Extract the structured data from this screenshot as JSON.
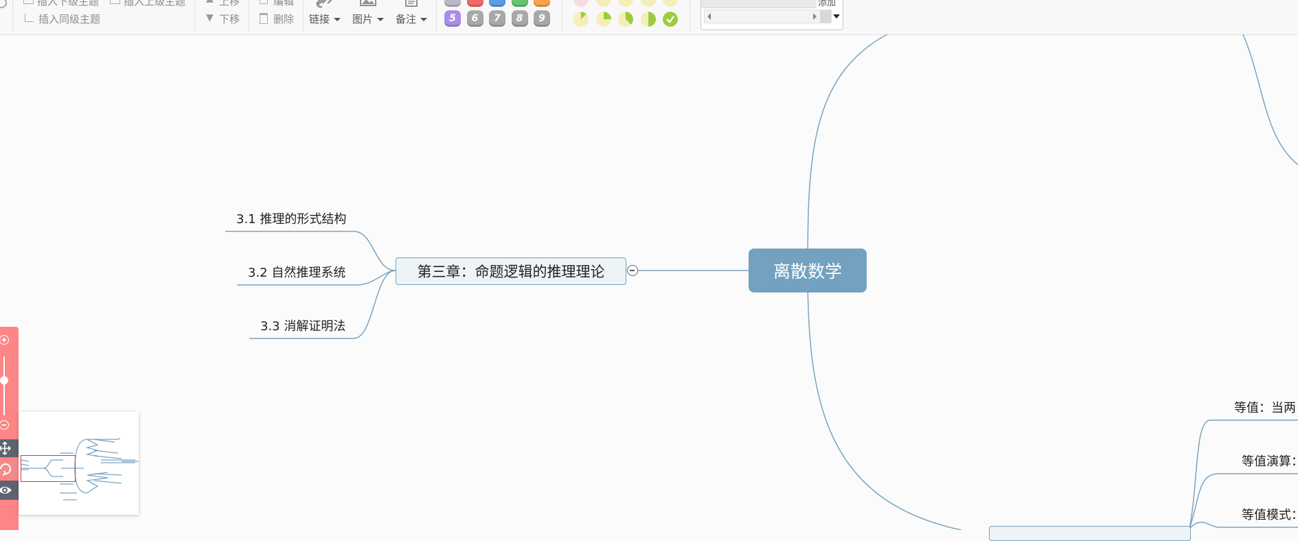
{
  "toolbar": {
    "insert_child_label": "插入下级主题",
    "insert_parent_label": "插入上级主题",
    "insert_sibling_label": "插入同级主题",
    "move_up_label": "上移",
    "move_down_label": "下移",
    "edit_label": "编辑",
    "delete_label": "删除",
    "link_label": "链接",
    "image_label": "图片",
    "note_label": "备注",
    "priorities": [
      "5",
      "6",
      "7",
      "8",
      "9"
    ],
    "priority_colors": [
      "#a98de7",
      "#a8a8a8",
      "#a8a8a8",
      "#a8a8a8",
      "#a8a8a8"
    ],
    "progress_levels": [
      0.125,
      0.25,
      0.375,
      0.5,
      1.0
    ],
    "template_label": "添加"
  },
  "mindmap": {
    "root": "离散数学",
    "chapter": "第三章：命题逻辑的推理理论",
    "subtopics": [
      "3.1 推理的形式结构",
      "3.2 自然推理系统",
      "3.3 消解证明法"
    ],
    "right_topics": [
      "等值：当两",
      "等值演算：",
      "等值模式："
    ]
  },
  "colors": {
    "branch_line": "#7aa4bf",
    "root_fill": "#73a1bf",
    "zoom_panel": "#fd8585",
    "minimap_view": "#e0302f"
  },
  "icons": [
    "plus-icon",
    "minus-icon",
    "move-icon",
    "refresh-icon",
    "eye-icon",
    "link-icon",
    "image-icon",
    "note-icon"
  ]
}
